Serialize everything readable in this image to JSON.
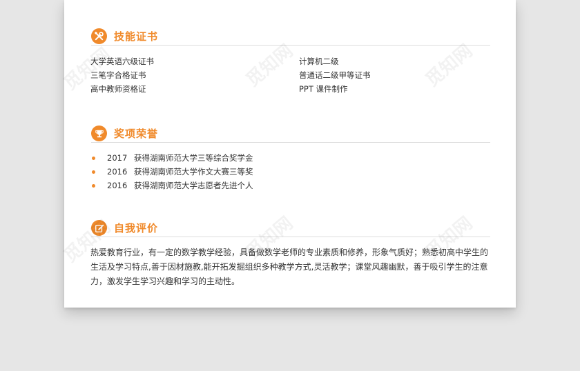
{
  "skills": {
    "title": "技能证书",
    "icon": "tools-icon",
    "left": [
      "大学英语六级证书",
      "三笔字合格证书",
      "高中教师资格证"
    ],
    "right": [
      "计算机二级",
      "普通话二级甲等证书",
      "PPT 课件制作"
    ]
  },
  "awards": {
    "title": "奖项荣誉",
    "icon": "trophy-icon",
    "items": [
      {
        "year": "2017",
        "text": "获得湖南师范大学三等综合奖学金"
      },
      {
        "year": "2016",
        "text": "获得湖南师范大学作文大赛三等奖"
      },
      {
        "year": "2016",
        "text": "获得湖南师范大学志愿者先进个人"
      }
    ]
  },
  "self_eval": {
    "title": "自我评价",
    "icon": "edit-icon",
    "text": "热爱教育行业，有一定的数学教学经验，具备做数学老师的专业素质和修养，形象气质好；熟悉初高中学生的生活及学习特点,善于因材施教,能开拓发掘组织多种教学方式,灵活教学；课堂风趣幽默，善于吸引学生的注意力，激发学生学习兴趣和学习的主动性。"
  },
  "watermark": "觅知网",
  "colors": {
    "accent": "#f08a2b",
    "background": "#e6e6e6",
    "paper": "#ffffff"
  }
}
